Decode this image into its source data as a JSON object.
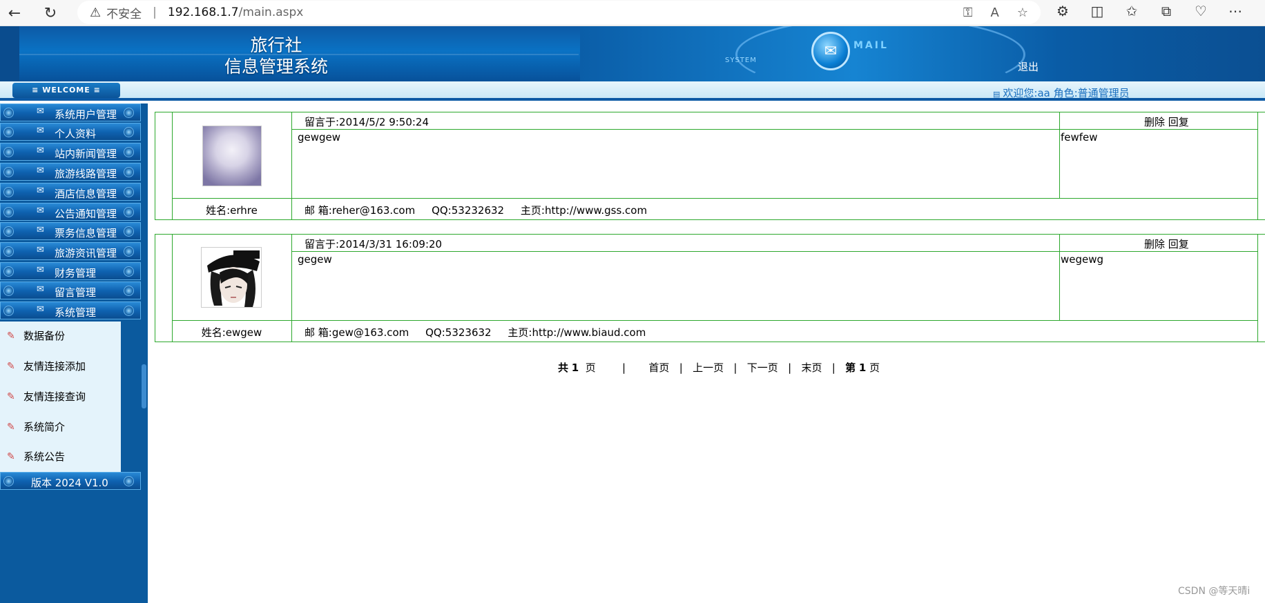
{
  "browser": {
    "insecure_label": "不安全",
    "url_host": "192.168.1.7",
    "url_path": "/main.aspx"
  },
  "header": {
    "title_line1": "旅行社",
    "title_line2": "信息管理系统",
    "mail_word": "MAIL",
    "system_word": "SYSTEM",
    "logout": "退出"
  },
  "welcome": {
    "tab": "≡ WELCOME ≡",
    "user_info": "欢迎您:aa 角色:普通管理员"
  },
  "sidebar": {
    "menu": [
      {
        "label": "系统用户管理"
      },
      {
        "label": "个人资料"
      },
      {
        "label": "站内新闻管理"
      },
      {
        "label": "旅游线路管理"
      },
      {
        "label": "酒店信息管理"
      },
      {
        "label": "公告通知管理"
      },
      {
        "label": "票务信息管理"
      },
      {
        "label": "旅游资讯管理"
      },
      {
        "label": "财务管理"
      },
      {
        "label": "留言管理"
      },
      {
        "label": "系统管理"
      }
    ],
    "submenu": [
      {
        "label": "数据备份"
      },
      {
        "label": "友情连接添加"
      },
      {
        "label": "友情连接查询"
      },
      {
        "label": "系统简介"
      },
      {
        "label": "系统公告"
      }
    ],
    "version": "版本 2024 V1.0"
  },
  "messages": [
    {
      "time": "留言于:2014/5/2 9:50:24",
      "ops_delete": "删除",
      "ops_reply": "回复",
      "content": "gewgew",
      "reply": "fewfew",
      "name": "姓名:erhre",
      "contact": "邮 箱:reher@163.com     QQ:53232632     主页:http://www.gss.com"
    },
    {
      "time": "留言于:2014/3/31 16:09:20",
      "ops_delete": "删除",
      "ops_reply": "回复",
      "content": "gegew",
      "reply": "wegewg",
      "name": "姓名:ewgew",
      "contact": "邮 箱:gew@163.com     QQ:5323632     主页:http://www.biaud.com"
    }
  ],
  "pager": {
    "total_prefix": "共",
    "total_pages": "1",
    "total_suffix": "页",
    "first": "首页",
    "prev": "上一页",
    "next": "下一页",
    "last": "末页",
    "current_prefix": "第",
    "current_page": "1",
    "current_suffix": "页"
  },
  "watermark": "CSDN @等天晴i",
  "colors": {
    "border_green": "#2ca82c",
    "header_blue": "#0a72c4",
    "sidebar_blue": "#0b5a9e"
  }
}
